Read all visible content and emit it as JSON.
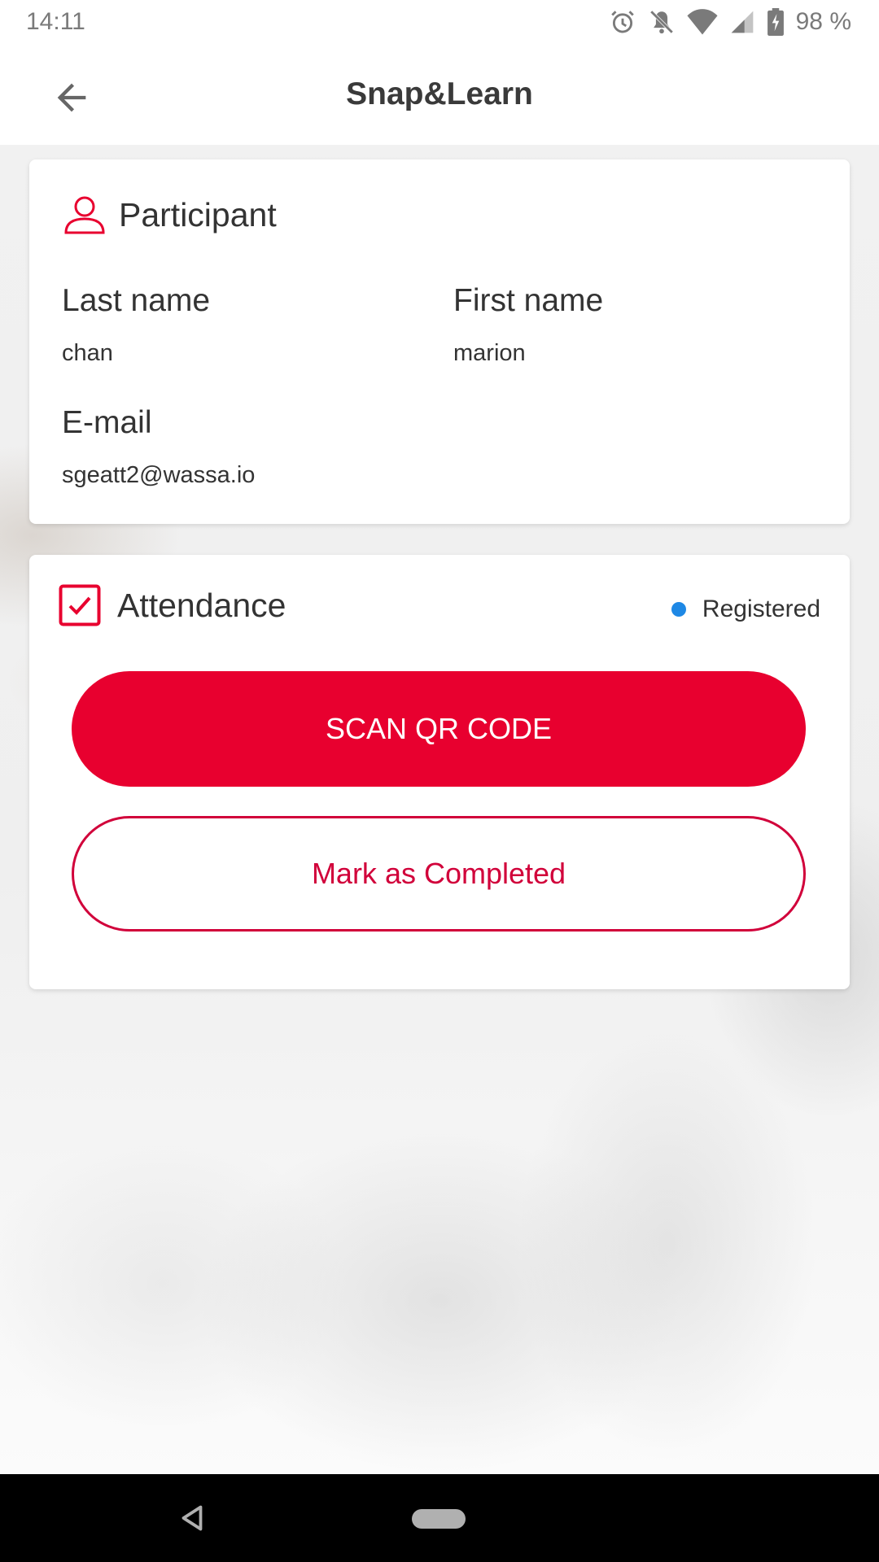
{
  "status_bar": {
    "time": "14:11",
    "battery": "98 %",
    "icons": [
      "alarm-icon",
      "notifications-off-icon",
      "wifi-icon",
      "cell-signal-icon",
      "battery-charging-icon"
    ]
  },
  "app_bar": {
    "title": "Snap&Learn",
    "back_icon": "arrow-back-icon"
  },
  "participant": {
    "title": "Participant",
    "icon": "person-icon",
    "last_name_label": "Last name",
    "last_name": "chan",
    "first_name_label": "First name",
    "first_name": "marion",
    "email_label": "E-mail",
    "email": "sgeatt2@wassa.io"
  },
  "attendance": {
    "title": "Attendance",
    "icon": "checkbox-checked-icon",
    "status": "Registered",
    "status_color": "#1e88e5",
    "scan_button": "SCAN QR CODE",
    "complete_button": "Mark as Completed"
  },
  "colors": {
    "accent": "#e8002f",
    "accent_outline": "#d1003a"
  },
  "nav_bar": {
    "back_icon": "nav-back-icon",
    "home_icon": "nav-home-pill-icon"
  }
}
